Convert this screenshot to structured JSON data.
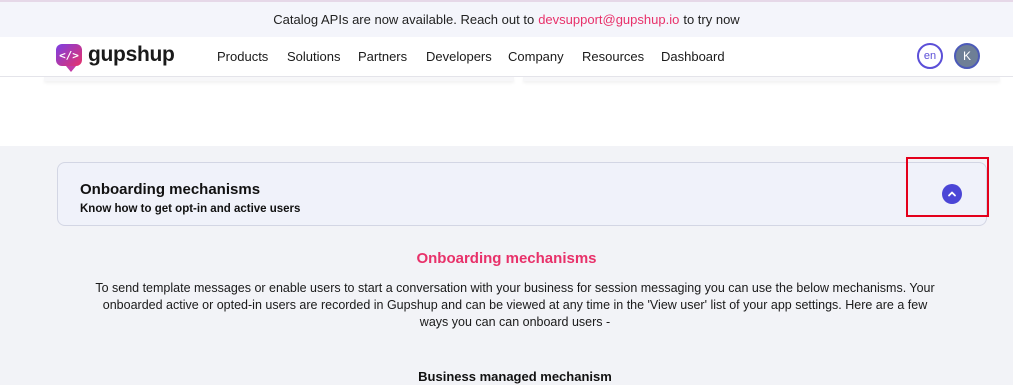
{
  "banner": {
    "prefix": "Catalog APIs are now available. Reach out to",
    "email": "devsupport@gupshup.io",
    "suffix": "to try now"
  },
  "header": {
    "logo_text": "gupshup",
    "logo_glyph": "</>",
    "nav_items": [
      "Products",
      "Solutions",
      "Partners",
      "Developers",
      "Company",
      "Resources",
      "Dashboard"
    ],
    "language": "en",
    "avatar_initial": "K"
  },
  "accordion": {
    "title": "Onboarding mechanisms",
    "subtitle": "Know how to get opt-in and active users",
    "toggle_icon": "chevron-up-icon",
    "expanded": true
  },
  "content": {
    "title": "Onboarding mechanisms",
    "body": "To send template messages or enable users to start a conversation with your business for session messaging you can use the below mechanisms. Your onboarded active or opted-in users are recorded in Gupshup and can be viewed at any time in the 'View user' list of your app settings. Here are a few ways you can can onboard users -",
    "sub_heading": "Business managed mechanism"
  },
  "colors": {
    "accent": "#e8316a",
    "primary": "#4b46d6",
    "highlight_box": "#e4001b"
  }
}
